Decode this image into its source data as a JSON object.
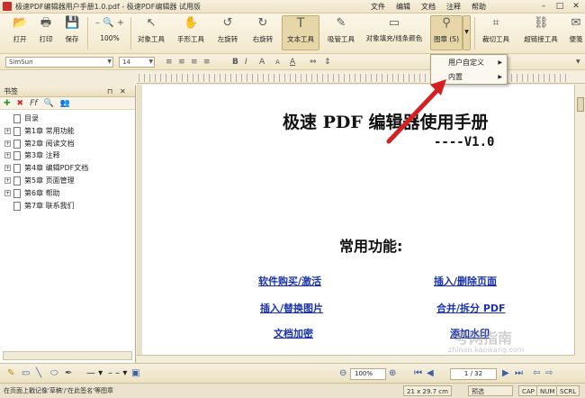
{
  "window": {
    "title": "极速PDF编辑器用户手册1.0.pdf - 极速PDF编辑器 试用版",
    "menus": [
      "文件",
      "编辑",
      "文档",
      "注释",
      "帮助"
    ],
    "controls": [
      "–",
      "□",
      "✕"
    ]
  },
  "toolbar": {
    "buttons": [
      {
        "label": "打开",
        "icon": "folder-open-icon",
        "glyph": "📂"
      },
      {
        "label": "打印",
        "icon": "printer-icon",
        "glyph": "🖶"
      },
      {
        "label": "保存",
        "icon": "save-icon",
        "glyph": "💾"
      },
      {
        "label": "100%",
        "icon": "zoom-icon",
        "glyph": "– 🔍 +"
      },
      {
        "label": "对象工具",
        "icon": "pointer-icon",
        "glyph": "↖"
      },
      {
        "label": "手形工具",
        "icon": "hand-icon",
        "glyph": "✋"
      },
      {
        "label": "左旋转",
        "icon": "rotate-left-icon",
        "glyph": "↺"
      },
      {
        "label": "右旋转",
        "icon": "rotate-right-icon",
        "glyph": "↻"
      },
      {
        "label": "文本工具",
        "icon": "text-tool-icon",
        "glyph": "T"
      },
      {
        "label": "吸管工具",
        "icon": "eyedropper-icon",
        "glyph": "✎"
      },
      {
        "label": "对象填充/线条颜色",
        "icon": "fill-color-icon",
        "glyph": "▭"
      },
      {
        "label": "图章 (S)",
        "icon": "stamp-icon",
        "glyph": "⚲"
      },
      {
        "label": "裁切工具",
        "icon": "crop-icon",
        "glyph": "⌗"
      },
      {
        "label": "超链接工具",
        "icon": "link-icon",
        "glyph": "⛓"
      },
      {
        "label": "便笺",
        "icon": "note-icon",
        "glyph": "✉"
      }
    ]
  },
  "format_bar": {
    "font": "SimSun",
    "size": "14",
    "styles": [
      "B",
      "I",
      "A",
      "A",
      "A"
    ]
  },
  "stamp_menu": {
    "items": [
      "用户自定义",
      "内置"
    ]
  },
  "bookmarks": {
    "header": "书签",
    "header_controls": [
      "⊓",
      "✕"
    ],
    "items": [
      {
        "label": "目录",
        "expandable": false
      },
      {
        "label": "第1章 常用功能",
        "expandable": true
      },
      {
        "label": "第2章 阅读文档",
        "expandable": true
      },
      {
        "label": "第3章 注释",
        "expandable": true
      },
      {
        "label": "第4章 编辑PDF文档",
        "expandable": true
      },
      {
        "label": "第5章 页面管理",
        "expandable": true
      },
      {
        "label": "第6章 帮助",
        "expandable": true
      },
      {
        "label": "第7章 联系我们",
        "expandable": false
      }
    ]
  },
  "document": {
    "title": "极速 PDF 编辑器使用手册",
    "version": "----V1.0",
    "subtitle": "常用功能:",
    "links": [
      "软件购买/激活",
      "插入/删除页面",
      "插入/替换图片",
      "合并/拆分 PDF",
      "文档加密",
      "添加水印"
    ]
  },
  "bottom": {
    "zoom": "100%",
    "page": "1 / 32"
  },
  "status": {
    "hint": "在页面上戳记像'草稿'/'在此签名'等图章",
    "size": "21 x 29.7 cm",
    "mode": "预选",
    "caps": "CAP",
    "num": "NUM",
    "scrl": "SCRL"
  },
  "watermark": {
    "text": "考网指南",
    "sub": "zhinan.kaowang.com"
  },
  "colors": {
    "accent_arrow": "#d42020",
    "link": "#1a33a8"
  }
}
